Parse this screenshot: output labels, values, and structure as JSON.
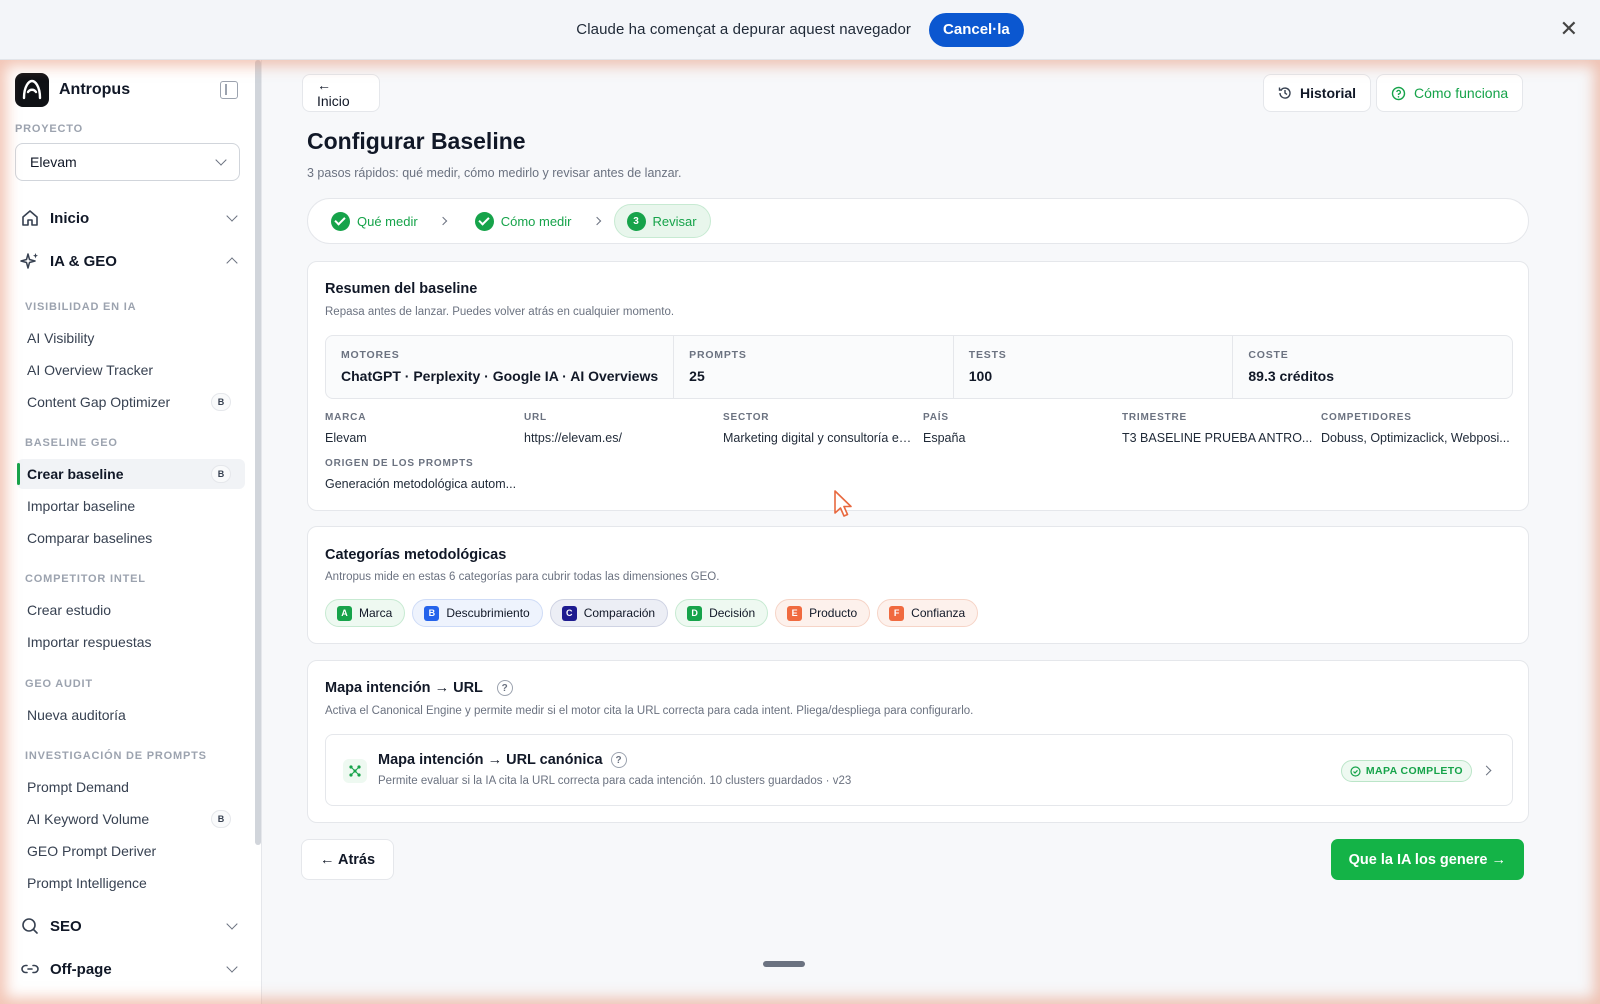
{
  "banner": {
    "text": "Claude ha començat a depurar aquest navegador",
    "cancel_label": "Cancel·la",
    "close_glyph": "✕"
  },
  "sidebar": {
    "brand": "Antropus",
    "project_label": "PROYECTO",
    "project_value": "Elevam",
    "top_items": [
      {
        "label": "Inicio",
        "icon": "home-icon"
      },
      {
        "label": "IA & GEO",
        "icon": "sparkles-icon"
      }
    ],
    "sections": [
      {
        "label": "VISIBILIDAD EN IA",
        "items": [
          {
            "label": "AI Visibility",
            "badge": ""
          },
          {
            "label": "AI Overview Tracker",
            "badge": ""
          },
          {
            "label": "Content Gap Optimizer",
            "badge": "B"
          }
        ]
      },
      {
        "label": "BASELINE GEO",
        "items": [
          {
            "label": "Crear baseline",
            "badge": "B"
          },
          {
            "label": "Importar baseline",
            "badge": ""
          },
          {
            "label": "Comparar baselines",
            "badge": ""
          }
        ]
      },
      {
        "label": "COMPETITOR INTEL",
        "items": [
          {
            "label": "Crear estudio",
            "badge": ""
          },
          {
            "label": "Importar respuestas",
            "badge": ""
          }
        ]
      },
      {
        "label": "GEO AUDIT",
        "items": [
          {
            "label": "Nueva auditoría",
            "badge": ""
          }
        ]
      },
      {
        "label": "INVESTIGACIÓN DE PROMPTS",
        "items": [
          {
            "label": "Prompt Demand",
            "badge": ""
          },
          {
            "label": "AI Keyword Volume",
            "badge": "B"
          },
          {
            "label": "GEO Prompt Deriver",
            "badge": ""
          },
          {
            "label": "Prompt Intelligence",
            "badge": ""
          }
        ]
      }
    ],
    "bottom_items": [
      {
        "label": "SEO",
        "icon": "search-icon"
      },
      {
        "label": "Off-page",
        "icon": "link-icon"
      }
    ]
  },
  "header": {
    "back_label": "← Inicio",
    "history_label": "Historial",
    "how_label": "Cómo funciona",
    "title": "Configurar Baseline",
    "subtitle": "3 pasos rápidos: qué medir, cómo medirlo y revisar antes de lanzar."
  },
  "steps": [
    {
      "label": "Qué medir",
      "state": "done"
    },
    {
      "label": "Cómo medir",
      "state": "done"
    },
    {
      "label": "Revisar",
      "state": "current",
      "number": "3"
    }
  ],
  "summary": {
    "title": "Resumen del baseline",
    "subtitle": "Repasa antes de lanzar. Puedes volver atrás en cualquier momento.",
    "stats": [
      {
        "key": "MOTORES",
        "value": "ChatGPT · Perplexity · Google IA · AI Overviews"
      },
      {
        "key": "PROMPTS",
        "value": "25"
      },
      {
        "key": "TESTS",
        "value": "100"
      },
      {
        "key": "COSTE",
        "value": "89.3 créditos"
      }
    ],
    "meta": [
      {
        "key": "MARCA",
        "value": "Elevam"
      },
      {
        "key": "URL",
        "value": "https://elevam.es/"
      },
      {
        "key": "SECTOR",
        "value": "Marketing digital y consultoría es..."
      },
      {
        "key": "PAÍS",
        "value": "España"
      },
      {
        "key": "TRIMESTRE",
        "value": "T3 BASELINE PRUEBA ANTRO..."
      },
      {
        "key": "COMPETIDORES",
        "value": "Dobuss, Optimizaclick, Webposi..."
      },
      {
        "key": "ORIGEN DE LOS PROMPTS",
        "value": "Generación metodológica autom..."
      }
    ]
  },
  "categories": {
    "title": "Categorías metodológicas",
    "subtitle": "Antropus mide en estas 6 categorías para cubrir todas las dimensiones GEO.",
    "items": [
      {
        "letter": "A",
        "label": "Marca",
        "color": "#16a34a",
        "bg": "#eef9f1",
        "border": "#c7ead2"
      },
      {
        "letter": "B",
        "label": "Descubrimiento",
        "color": "#2563eb",
        "bg": "#eef3fd",
        "border": "#cfdcf7"
      },
      {
        "letter": "C",
        "label": "Comparación",
        "color": "#1e1b8f",
        "bg": "#eceef5",
        "border": "#cfd3e3"
      },
      {
        "letter": "D",
        "label": "Decisión",
        "color": "#16a34a",
        "bg": "#eef9f1",
        "border": "#c7ead2"
      },
      {
        "letter": "E",
        "label": "Producto",
        "color": "#f06a3f",
        "bg": "#fdf1ec",
        "border": "#f6d4c7"
      },
      {
        "letter": "F",
        "label": "Confianza",
        "color": "#f06a3f",
        "bg": "#fdf1ec",
        "border": "#f6d4c7"
      }
    ]
  },
  "intent_map": {
    "title": "Mapa intención → URL",
    "help": "?",
    "subtitle": "Activa el Canonical Engine y permite medir si el motor cita la URL correcta para cada intent. Pliega/despliega para configurarlo.",
    "item_title": "Mapa intención → URL canónica",
    "item_subtitle": "Permite evaluar si la IA cita la URL correcta para cada intención. 10 clusters guardados · v23",
    "status": "MAPA COMPLETO"
  },
  "footer": {
    "back_label": "← Atrás",
    "next_label": "Que la IA los genere →"
  },
  "colors": {
    "accent": "#16a34a",
    "primary_button": "#14b347",
    "banner_button": "#0b57d0"
  }
}
